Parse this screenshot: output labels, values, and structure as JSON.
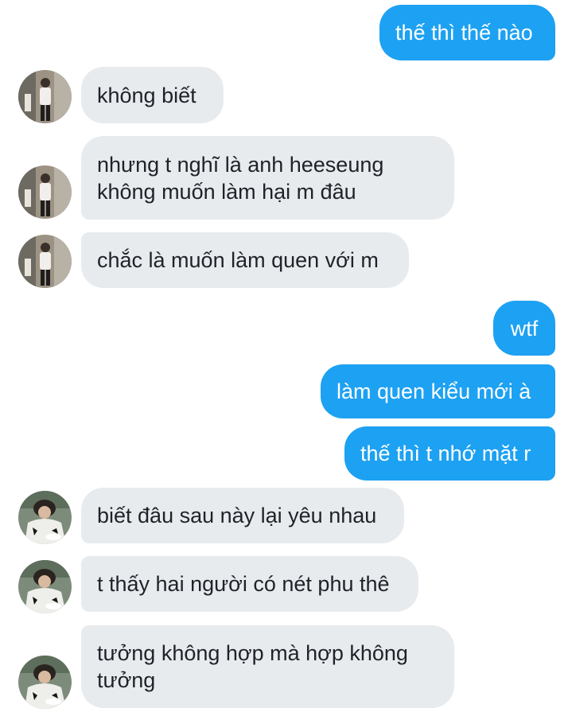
{
  "conversation": {
    "messages": [
      {
        "text": "thế thì thế nào",
        "from": "me"
      },
      {
        "text": "không biết",
        "from": "friend_a"
      },
      {
        "text": "nhưng t nghĩ là anh heeseung\nkhông muốn làm hại m đâu",
        "from": "friend_a"
      },
      {
        "text": "chắc là muốn làm quen với m",
        "from": "friend_a"
      },
      {
        "text": "wtf",
        "from": "me"
      },
      {
        "text": "làm quen kiểu mới à",
        "from": "me"
      },
      {
        "text": "thế thì t nhớ mặt r",
        "from": "me"
      },
      {
        "text": "biết đâu sau này lại yêu nhau",
        "from": "friend_b"
      },
      {
        "text": "t thấy hai người có nét phu thê",
        "from": "friend_b"
      },
      {
        "text": "tưởng không hợp mà hợp không\ntưởng",
        "from": "friend_b"
      }
    ]
  },
  "colors": {
    "outgoing_bubble": "#1da1f2",
    "incoming_bubble": "#e8ebee",
    "incoming_text": "#1f2329",
    "outgoing_text": "#ffffff",
    "background": "#ffffff"
  }
}
